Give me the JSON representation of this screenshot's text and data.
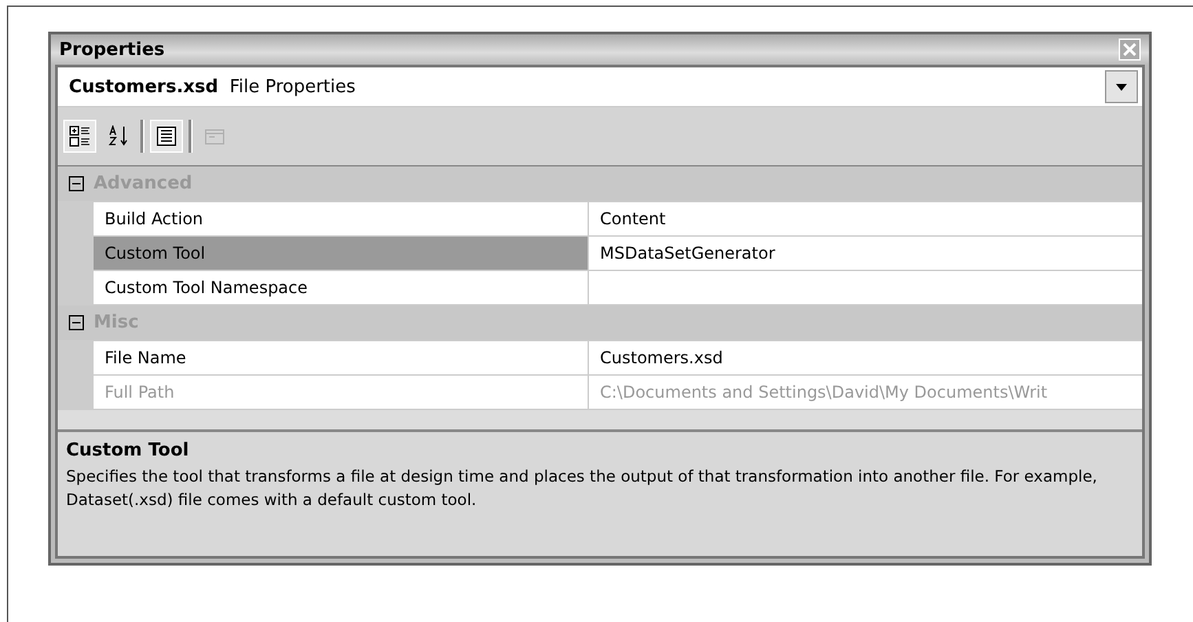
{
  "panel": {
    "title": "Properties"
  },
  "object_selector": {
    "name": "Customers.xsd",
    "type": "File Properties"
  },
  "toolbar": [
    {
      "kind": "categorized",
      "selected": true,
      "disabled": false
    },
    {
      "kind": "alphabetical",
      "selected": false,
      "disabled": false
    },
    {
      "kind": "properties",
      "selected": true,
      "disabled": false
    },
    {
      "kind": "events",
      "selected": false,
      "disabled": true
    }
  ],
  "categories": [
    {
      "label": "Advanced",
      "expanded": true,
      "properties": [
        {
          "name": "Build Action",
          "value": "Content",
          "selected": false,
          "disabled": false
        },
        {
          "name": "Custom Tool",
          "value": "MSDataSetGenerator",
          "selected": true,
          "disabled": false
        },
        {
          "name": "Custom Tool Namespace",
          "selected": false,
          "disabled": false
        }
      ]
    },
    {
      "label": "Misc",
      "expanded": true,
      "properties": [
        {
          "name": "File Name",
          "value": "Customers.xsd",
          "selected": false,
          "disabled": false
        },
        {
          "name": "Full Path",
          "value": "C:\\Documents and Settings\\David\\My Documents\\Writ",
          "selected": false,
          "disabled": true
        }
      ]
    }
  ],
  "description": {
    "title": "Custom Tool",
    "text": "Specifies the tool that transforms a file at design time and places the output of that transformation into another file. For example, Dataset(.xsd) file comes with a default custom tool."
  }
}
